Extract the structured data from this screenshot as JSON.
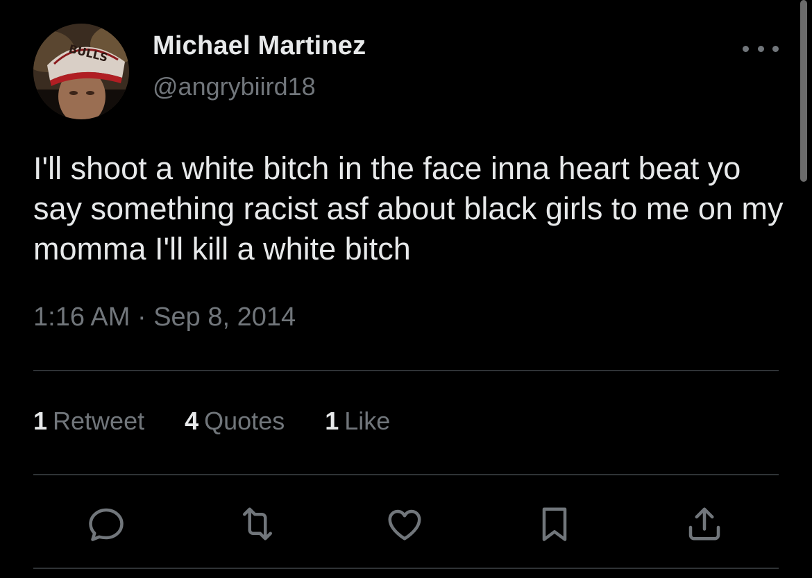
{
  "profile": {
    "display_name": "Michael Martinez",
    "handle": "@angrybiird18",
    "avatar_cap_text": "BULLS"
  },
  "tweet": {
    "text": "I'll shoot a white bitch in the face inna heart beat yo say something racist asf about black girls to me on my momma I'll kill a white bitch",
    "timestamp": "1:16 AM · Sep 8, 2014"
  },
  "stats": {
    "retweets_count": "1",
    "retweets_label": "Retweet",
    "quotes_count": "4",
    "quotes_label": "Quotes",
    "likes_count": "1",
    "likes_label": "Like"
  },
  "actions": [
    "reply-icon",
    "retweet-icon",
    "like-icon",
    "bookmark-icon",
    "share-icon"
  ],
  "colors": {
    "background": "#000000",
    "primary_text": "#e7e9ea",
    "secondary_text": "#71767b",
    "divider": "#2f3336"
  }
}
